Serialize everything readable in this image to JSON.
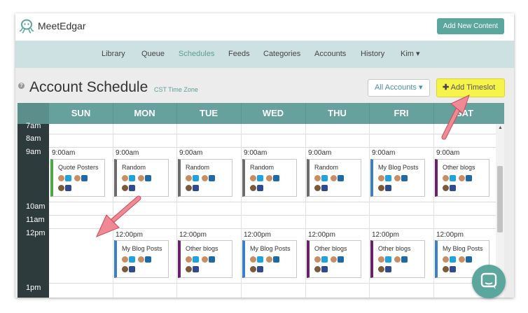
{
  "app": {
    "logo_text": "MeetEdgar",
    "add_content_label": "Add New Content"
  },
  "nav": {
    "items": [
      "Library",
      "Queue",
      "Schedules",
      "Feeds",
      "Categories",
      "Accounts",
      "History",
      "Kim ▾"
    ],
    "active": "Schedules"
  },
  "page": {
    "title": "Account Schedule",
    "timezone": "CST Time Zone",
    "accounts_select": "All Accounts ▾",
    "add_timeslot_label": "Add Timeslot",
    "add_timeslot_icon": "✚"
  },
  "days": [
    "SUN",
    "MON",
    "TUE",
    "WED",
    "THU",
    "FRI",
    "SAT"
  ],
  "times": [
    "7am",
    "8am",
    "9am",
    "10am",
    "11am",
    "12pm",
    "1pm"
  ],
  "slots_9am": {
    "time": "9:00am",
    "cards": [
      {
        "day": "SUN",
        "label": "Quote Posters",
        "color": "#4caa46"
      },
      {
        "day": "MON",
        "label": "Random",
        "color": "#6b6b6b"
      },
      {
        "day": "TUE",
        "label": "Random",
        "color": "#6b6b6b"
      },
      {
        "day": "WED",
        "label": "Random",
        "color": "#6b6b6b"
      },
      {
        "day": "THU",
        "label": "Random",
        "color": "#6b6b6b"
      },
      {
        "day": "FRI",
        "label": "My Blog Posts",
        "color": "#3a7fc9"
      },
      {
        "day": "SAT",
        "label": "Other blogs",
        "color": "#6d1f6f"
      }
    ]
  },
  "slots_12pm": {
    "time": "12:00pm",
    "cards": [
      {
        "day": "MON",
        "label": "My Blog Posts",
        "color": "#3a7fc9"
      },
      {
        "day": "TUE",
        "label": "Other blogs",
        "color": "#6d1f6f"
      },
      {
        "day": "WED",
        "label": "My Blog Posts",
        "color": "#3a7fc9"
      },
      {
        "day": "THU",
        "label": "Other blogs",
        "color": "#6d1f6f"
      },
      {
        "day": "FRI",
        "label": "Other blogs",
        "color": "#6d1f6f"
      },
      {
        "day": "SAT",
        "label": "My Blog Posts",
        "color": "#3a7fc9"
      }
    ]
  },
  "colors": {
    "accent": "#5ba79d",
    "header": "#67a19e",
    "rail": "#2e3b3c",
    "highlight_button": "#f6f34a",
    "arrow": "#e8737f"
  }
}
